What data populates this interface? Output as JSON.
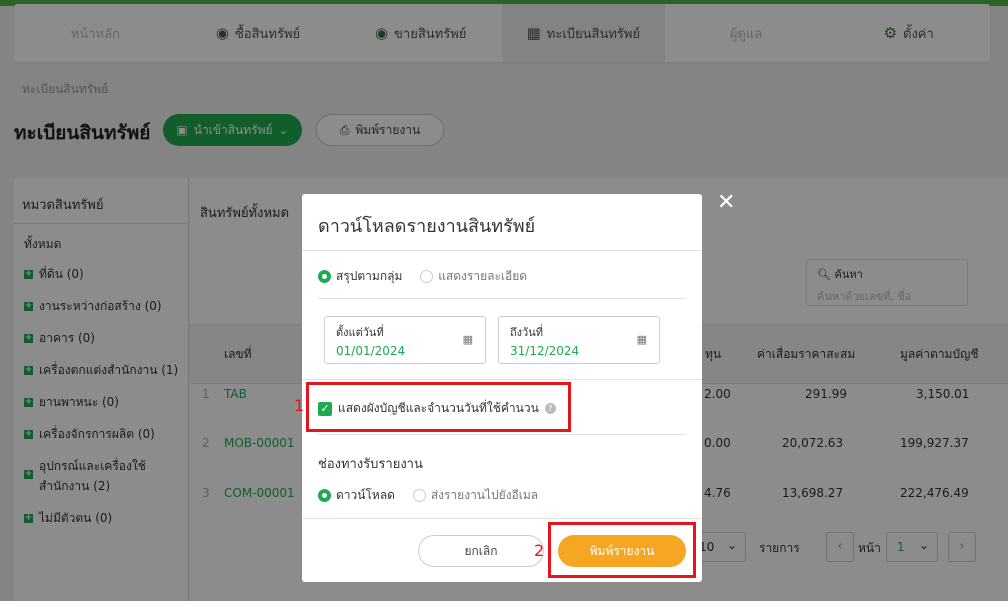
{
  "nav": {
    "items": [
      {
        "label": "หน้าหลัก"
      },
      {
        "label": "ซื้อสินทรัพย์"
      },
      {
        "label": "ขายสินทรัพย์"
      },
      {
        "label": "ทะเบียนสินทรัพย์"
      },
      {
        "label": "ผู้ดูแล"
      },
      {
        "label": "ตั้งค่า"
      }
    ]
  },
  "breadcrumb": "ทะเบียนสินทรัพย์",
  "page": {
    "title": "ทะเบียนสินทรัพย์",
    "import_button": "นำเข้าสินทรัพย์",
    "print_button": "พิมพ์รายงาน"
  },
  "sidebar": {
    "title": "หมวดสินทรัพย์",
    "all": "ทั้งหมด",
    "categories": [
      {
        "label": "ที่ดิน (0)"
      },
      {
        "label": "งานระหว่างก่อสร้าง (0)"
      },
      {
        "label": "อาคาร (0)"
      },
      {
        "label": "เครื่องตกแต่งสำนักงาน (1)"
      },
      {
        "label": "ยานพาหนะ (0)"
      },
      {
        "label": "เครื่องจักรการผลิต (0)"
      },
      {
        "label": "อุปกรณ์และเครื่องใช้",
        "label2": "สำนักงาน (2)"
      },
      {
        "label": "ไม่มีตัวตน (0)"
      }
    ]
  },
  "main": {
    "heading": "สินทรัพย์ทั้งหมด",
    "search": {
      "label": "ค้นหา",
      "placeholder": "ค้นหาด้วยเลขที่, ชื่อ"
    },
    "columns": {
      "no": "เลขที่",
      "cost": "ทุน",
      "depreciation": "ค่าเสื่อมราคาสะสม",
      "book_value": "มูลค่าตามบัญชี"
    },
    "rows": [
      {
        "idx": "1",
        "no": "TAB",
        "cost": "2.00",
        "depreciation": "291.99",
        "book_value": "3,150.01"
      },
      {
        "idx": "2",
        "no": "MOB-00001",
        "cost": "0.00",
        "depreciation": "20,072.63",
        "book_value": "199,927.37"
      },
      {
        "idx": "3",
        "no": "COM-00001",
        "cost": "4.76",
        "depreciation": "13,698.27",
        "book_value": "222,476.49"
      }
    ],
    "pager": {
      "per_page": "10",
      "items_label": "รายการ",
      "page_label": "หน้า",
      "page": "1"
    }
  },
  "modal": {
    "title": "ดาวน์โหลดรายงานสินทรัพย์",
    "mode_summary": "สรุปตามกลุ่ม",
    "mode_detail": "แสดงรายละเอียด",
    "from_label": "ตั้งแต่วันที่",
    "from_value": "01/01/2024",
    "to_label": "ถึงวันที่",
    "to_value": "31/12/2024",
    "show_chart_label": "แสดงผังบัญชีและจำนวนวันที่ใช้คำนวน",
    "channel_title": "ช่องทางรับรายงาน",
    "channel_download": "ดาวน์โหลด",
    "channel_email": "ส่งรายงานไปยังอีเมล",
    "cancel": "ยกเลิก",
    "print": "พิมพ์รายงาน"
  },
  "annotations": {
    "one": "1",
    "two": "2"
  },
  "colors": {
    "accent": "#1faa4f",
    "print_button": "#f5a623",
    "highlight": "#e8141d"
  }
}
